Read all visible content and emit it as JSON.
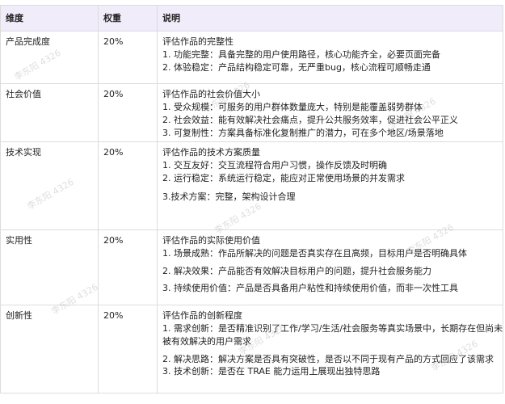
{
  "headers": [
    "维度",
    "权重",
    "说明"
  ],
  "rows": [
    {
      "dimension": "产品完成度",
      "weight": "20%",
      "lines": [
        "评估作品的完整性",
        "1. 功能完整：具备完整的用户使用路径，核心功能齐全，必要页面完备",
        "2. 体验稳定：产品结构稳定可靠，无严重bug，核心流程可顺畅走通"
      ]
    },
    {
      "dimension": "社会价值",
      "weight": "20%",
      "lines": [
        "评估作品的社会价值大小",
        "1. 受众规模：可服务的用户群体数量庞大，特别是能覆盖弱势群体",
        "2. 社会效益：能有效解决社会痛点，提升公共服务效率，促进社会公平正义",
        "3. 可复制性：方案具备标准化复制推广的潜力，可在多个地区/场景落地"
      ]
    },
    {
      "dimension": "技术实现",
      "weight": "20%",
      "lines": [
        "评估作品的技术方案质量",
        "1. 交互友好：交互流程符合用户习惯，操作反馈及时明确",
        "2. 运行稳定：系统运行稳定，能应对正常使用场景的并发需求",
        "3.技术方案：完整，架构设计合理"
      ]
    },
    {
      "dimension": "实用性",
      "weight": "20%",
      "lines": [
        "评估作品的实际使用价值",
        "1. 场景成熟：作品所解决的问题是否真实存在且高频，目标用户是否明确具体",
        "2. 解决效果：产品能否有效解决目标用户的问题，提升社会服务能力",
        "3. 持续使用价值：产品是否具备用户粘性和持续使用价值，而非一次性工具"
      ]
    },
    {
      "dimension": "创新性",
      "weight": "20%",
      "lines": [
        "评估作品的创新程度",
        "1. 需求创新：是否精准识别了工作/学习/生活/社会服务等真实场景中，长期存在但尚未",
        "被有效解决的用户需求",
        "2. 解决思路：解决方案是否具有突破性，是否以不同于现有产品的方式回应了该需求",
        "3. 技术创新：是否在 TRAE 能力运用上展现出独特思路"
      ]
    }
  ],
  "watermark": "李东阳 4326"
}
